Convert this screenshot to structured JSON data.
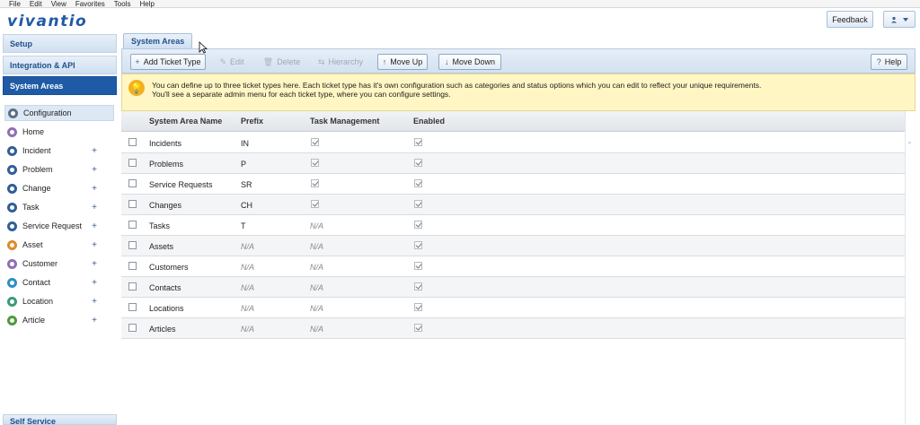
{
  "menubar": [
    "File",
    "Edit",
    "View",
    "Favorites",
    "Tools",
    "Help"
  ],
  "brand": "vivantio",
  "header": {
    "feedback_label": "Feedback",
    "user_icon": "user-icon"
  },
  "sidebar": {
    "sections": [
      "Setup",
      "Integration & API",
      "System Areas"
    ],
    "items": [
      {
        "label": "Configuration",
        "color": "#5a6f85",
        "plus": ""
      },
      {
        "label": "Home",
        "color": "#8e6fb5",
        "plus": ""
      },
      {
        "label": "Incident",
        "color": "#2f5f99",
        "plus": "+"
      },
      {
        "label": "Problem",
        "color": "#2f5f99",
        "plus": "+"
      },
      {
        "label": "Change",
        "color": "#2f5f99",
        "plus": "+"
      },
      {
        "label": "Task",
        "color": "#2f5f99",
        "plus": "+"
      },
      {
        "label": "Service Request",
        "color": "#2f5f99",
        "plus": "+"
      },
      {
        "label": "Asset",
        "color": "#e08a2a",
        "plus": "+"
      },
      {
        "label": "Customer",
        "color": "#8e6fb5",
        "plus": "+"
      },
      {
        "label": "Contact",
        "color": "#2b8fc8",
        "plus": "+"
      },
      {
        "label": "Location",
        "color": "#3b9a7a",
        "plus": "+"
      },
      {
        "label": "Article",
        "color": "#4d9a3c",
        "plus": "+"
      }
    ],
    "bottom_section": "Self Service"
  },
  "tab": {
    "label": "System Areas"
  },
  "toolbar": {
    "add": "Add Ticket Type",
    "edit": "Edit",
    "delete": "Delete",
    "hierarchy": "Hierarchy",
    "move_up": "Move Up",
    "move_down": "Move Down",
    "help": "Help"
  },
  "notice": {
    "line1": "You can define up to three ticket types here. Each ticket type has it's own configuration such as categories and status options which you can edit to reflect your unique requirements.",
    "line2": "You'll see a separate admin menu for each ticket type, where you can configure settings."
  },
  "grid": {
    "columns": [
      "System Area Name",
      "Prefix",
      "Task Management",
      "Enabled"
    ],
    "rows": [
      {
        "name": "Incidents",
        "prefix": "IN",
        "task": "check",
        "enabled": "check"
      },
      {
        "name": "Problems",
        "prefix": "P",
        "task": "check",
        "enabled": "check"
      },
      {
        "name": "Service Requests",
        "prefix": "SR",
        "task": "check",
        "enabled": "check"
      },
      {
        "name": "Changes",
        "prefix": "CH",
        "task": "check",
        "enabled": "check"
      },
      {
        "name": "Tasks",
        "prefix": "T",
        "task": "N/A",
        "enabled": "check"
      },
      {
        "name": "Assets",
        "prefix": "N/A",
        "task": "N/A",
        "enabled": "check"
      },
      {
        "name": "Customers",
        "prefix": "N/A",
        "task": "N/A",
        "enabled": "check"
      },
      {
        "name": "Contacts",
        "prefix": "N/A",
        "task": "N/A",
        "enabled": "check"
      },
      {
        "name": "Locations",
        "prefix": "N/A",
        "task": "N/A",
        "enabled": "check"
      },
      {
        "name": "Articles",
        "prefix": "N/A",
        "task": "N/A",
        "enabled": "check"
      }
    ]
  }
}
